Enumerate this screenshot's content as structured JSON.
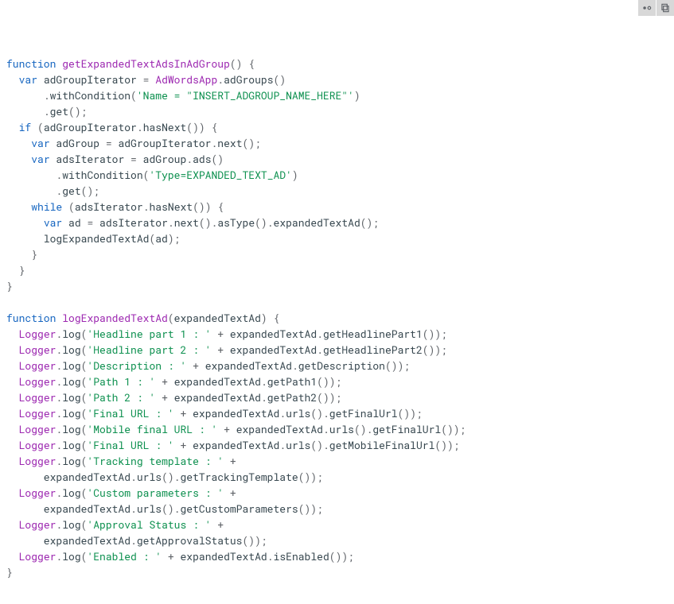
{
  "toolbar": {
    "btn_theme": "toggle-theme",
    "btn_copy": "copy-code"
  },
  "code_tokens": [
    [
      [
        "kw",
        "function"
      ],
      [
        "plain",
        " "
      ],
      [
        "fn",
        "getExpandedTextAdsInAdGroup"
      ],
      [
        "punc",
        "()"
      ],
      [
        "plain",
        " "
      ],
      [
        "punc",
        "{"
      ]
    ],
    [
      [
        "plain",
        "  "
      ],
      [
        "kw",
        "var"
      ],
      [
        "plain",
        " adGroupIterator "
      ],
      [
        "punc",
        "="
      ],
      [
        "plain",
        " "
      ],
      [
        "type",
        "AdWordsApp"
      ],
      [
        "punc",
        "."
      ],
      [
        "plain",
        "adGroups"
      ],
      [
        "punc",
        "()"
      ]
    ],
    [
      [
        "plain",
        "      "
      ],
      [
        "punc",
        "."
      ],
      [
        "plain",
        "withCondition"
      ],
      [
        "punc",
        "("
      ],
      [
        "str",
        "'Name = \"INSERT_ADGROUP_NAME_HERE\"'"
      ],
      [
        "punc",
        ")"
      ]
    ],
    [
      [
        "plain",
        "      "
      ],
      [
        "punc",
        "."
      ],
      [
        "plain",
        "get"
      ],
      [
        "punc",
        "();"
      ]
    ],
    [
      [
        "plain",
        "  "
      ],
      [
        "kw",
        "if"
      ],
      [
        "plain",
        " "
      ],
      [
        "punc",
        "("
      ],
      [
        "plain",
        "adGroupIterator"
      ],
      [
        "punc",
        "."
      ],
      [
        "plain",
        "hasNext"
      ],
      [
        "punc",
        "())"
      ],
      [
        "plain",
        " "
      ],
      [
        "punc",
        "{"
      ]
    ],
    [
      [
        "plain",
        "    "
      ],
      [
        "kw",
        "var"
      ],
      [
        "plain",
        " adGroup "
      ],
      [
        "punc",
        "="
      ],
      [
        "plain",
        " adGroupIterator"
      ],
      [
        "punc",
        "."
      ],
      [
        "plain",
        "next"
      ],
      [
        "punc",
        "();"
      ]
    ],
    [
      [
        "plain",
        "    "
      ],
      [
        "kw",
        "var"
      ],
      [
        "plain",
        " adsIterator "
      ],
      [
        "punc",
        "="
      ],
      [
        "plain",
        " adGroup"
      ],
      [
        "punc",
        "."
      ],
      [
        "plain",
        "ads"
      ],
      [
        "punc",
        "()"
      ]
    ],
    [
      [
        "plain",
        "        "
      ],
      [
        "punc",
        "."
      ],
      [
        "plain",
        "withCondition"
      ],
      [
        "punc",
        "("
      ],
      [
        "str",
        "'Type=EXPANDED_TEXT_AD'"
      ],
      [
        "punc",
        ")"
      ]
    ],
    [
      [
        "plain",
        "        "
      ],
      [
        "punc",
        "."
      ],
      [
        "plain",
        "get"
      ],
      [
        "punc",
        "();"
      ]
    ],
    [
      [
        "plain",
        "    "
      ],
      [
        "kw",
        "while"
      ],
      [
        "plain",
        " "
      ],
      [
        "punc",
        "("
      ],
      [
        "plain",
        "adsIterator"
      ],
      [
        "punc",
        "."
      ],
      [
        "plain",
        "hasNext"
      ],
      [
        "punc",
        "())"
      ],
      [
        "plain",
        " "
      ],
      [
        "punc",
        "{"
      ]
    ],
    [
      [
        "plain",
        "      "
      ],
      [
        "kw",
        "var"
      ],
      [
        "plain",
        " ad "
      ],
      [
        "punc",
        "="
      ],
      [
        "plain",
        " adsIterator"
      ],
      [
        "punc",
        "."
      ],
      [
        "plain",
        "next"
      ],
      [
        "punc",
        "()."
      ],
      [
        "plain",
        "asType"
      ],
      [
        "punc",
        "()."
      ],
      [
        "plain",
        "expandedTextAd"
      ],
      [
        "punc",
        "();"
      ]
    ],
    [
      [
        "plain",
        "      logExpandedTextAd"
      ],
      [
        "punc",
        "("
      ],
      [
        "plain",
        "ad"
      ],
      [
        "punc",
        ");"
      ]
    ],
    [
      [
        "plain",
        "    "
      ],
      [
        "punc",
        "}"
      ]
    ],
    [
      [
        "plain",
        "  "
      ],
      [
        "punc",
        "}"
      ]
    ],
    [
      [
        "punc",
        "}"
      ]
    ],
    [
      [
        "plain",
        ""
      ]
    ],
    [
      [
        "kw",
        "function"
      ],
      [
        "plain",
        " "
      ],
      [
        "fn",
        "logExpandedTextAd"
      ],
      [
        "punc",
        "("
      ],
      [
        "plain",
        "expandedTextAd"
      ],
      [
        "punc",
        ")"
      ],
      [
        "plain",
        " "
      ],
      [
        "punc",
        "{"
      ]
    ],
    [
      [
        "plain",
        "  "
      ],
      [
        "type",
        "Logger"
      ],
      [
        "punc",
        "."
      ],
      [
        "plain",
        "log"
      ],
      [
        "punc",
        "("
      ],
      [
        "str",
        "'Headline part 1 : '"
      ],
      [
        "plain",
        " "
      ],
      [
        "punc",
        "+"
      ],
      [
        "plain",
        " expandedTextAd"
      ],
      [
        "punc",
        "."
      ],
      [
        "plain",
        "getHeadlinePart1"
      ],
      [
        "punc",
        "());"
      ]
    ],
    [
      [
        "plain",
        "  "
      ],
      [
        "type",
        "Logger"
      ],
      [
        "punc",
        "."
      ],
      [
        "plain",
        "log"
      ],
      [
        "punc",
        "("
      ],
      [
        "str",
        "'Headline part 2 : '"
      ],
      [
        "plain",
        " "
      ],
      [
        "punc",
        "+"
      ],
      [
        "plain",
        " expandedTextAd"
      ],
      [
        "punc",
        "."
      ],
      [
        "plain",
        "getHeadlinePart2"
      ],
      [
        "punc",
        "());"
      ]
    ],
    [
      [
        "plain",
        "  "
      ],
      [
        "type",
        "Logger"
      ],
      [
        "punc",
        "."
      ],
      [
        "plain",
        "log"
      ],
      [
        "punc",
        "("
      ],
      [
        "str",
        "'Description : '"
      ],
      [
        "plain",
        " "
      ],
      [
        "punc",
        "+"
      ],
      [
        "plain",
        " expandedTextAd"
      ],
      [
        "punc",
        "."
      ],
      [
        "plain",
        "getDescription"
      ],
      [
        "punc",
        "());"
      ]
    ],
    [
      [
        "plain",
        "  "
      ],
      [
        "type",
        "Logger"
      ],
      [
        "punc",
        "."
      ],
      [
        "plain",
        "log"
      ],
      [
        "punc",
        "("
      ],
      [
        "str",
        "'Path 1 : '"
      ],
      [
        "plain",
        " "
      ],
      [
        "punc",
        "+"
      ],
      [
        "plain",
        " expandedTextAd"
      ],
      [
        "punc",
        "."
      ],
      [
        "plain",
        "getPath1"
      ],
      [
        "punc",
        "());"
      ]
    ],
    [
      [
        "plain",
        "  "
      ],
      [
        "type",
        "Logger"
      ],
      [
        "punc",
        "."
      ],
      [
        "plain",
        "log"
      ],
      [
        "punc",
        "("
      ],
      [
        "str",
        "'Path 2 : '"
      ],
      [
        "plain",
        " "
      ],
      [
        "punc",
        "+"
      ],
      [
        "plain",
        " expandedTextAd"
      ],
      [
        "punc",
        "."
      ],
      [
        "plain",
        "getPath2"
      ],
      [
        "punc",
        "());"
      ]
    ],
    [
      [
        "plain",
        "  "
      ],
      [
        "type",
        "Logger"
      ],
      [
        "punc",
        "."
      ],
      [
        "plain",
        "log"
      ],
      [
        "punc",
        "("
      ],
      [
        "str",
        "'Final URL : '"
      ],
      [
        "plain",
        " "
      ],
      [
        "punc",
        "+"
      ],
      [
        "plain",
        " expandedTextAd"
      ],
      [
        "punc",
        "."
      ],
      [
        "plain",
        "urls"
      ],
      [
        "punc",
        "()."
      ],
      [
        "plain",
        "getFinalUrl"
      ],
      [
        "punc",
        "());"
      ]
    ],
    [
      [
        "plain",
        "  "
      ],
      [
        "type",
        "Logger"
      ],
      [
        "punc",
        "."
      ],
      [
        "plain",
        "log"
      ],
      [
        "punc",
        "("
      ],
      [
        "str",
        "'Mobile final URL : '"
      ],
      [
        "plain",
        " "
      ],
      [
        "punc",
        "+"
      ],
      [
        "plain",
        " expandedTextAd"
      ],
      [
        "punc",
        "."
      ],
      [
        "plain",
        "urls"
      ],
      [
        "punc",
        "()."
      ],
      [
        "plain",
        "getFinalUrl"
      ],
      [
        "punc",
        "());"
      ]
    ],
    [
      [
        "plain",
        "  "
      ],
      [
        "type",
        "Logger"
      ],
      [
        "punc",
        "."
      ],
      [
        "plain",
        "log"
      ],
      [
        "punc",
        "("
      ],
      [
        "str",
        "'Final URL : '"
      ],
      [
        "plain",
        " "
      ],
      [
        "punc",
        "+"
      ],
      [
        "plain",
        " expandedTextAd"
      ],
      [
        "punc",
        "."
      ],
      [
        "plain",
        "urls"
      ],
      [
        "punc",
        "()."
      ],
      [
        "plain",
        "getMobileFinalUrl"
      ],
      [
        "punc",
        "());"
      ]
    ],
    [
      [
        "plain",
        "  "
      ],
      [
        "type",
        "Logger"
      ],
      [
        "punc",
        "."
      ],
      [
        "plain",
        "log"
      ],
      [
        "punc",
        "("
      ],
      [
        "str",
        "'Tracking template : '"
      ],
      [
        "plain",
        " "
      ],
      [
        "punc",
        "+"
      ]
    ],
    [
      [
        "plain",
        "      expandedTextAd"
      ],
      [
        "punc",
        "."
      ],
      [
        "plain",
        "urls"
      ],
      [
        "punc",
        "()."
      ],
      [
        "plain",
        "getTrackingTemplate"
      ],
      [
        "punc",
        "());"
      ]
    ],
    [
      [
        "plain",
        "  "
      ],
      [
        "type",
        "Logger"
      ],
      [
        "punc",
        "."
      ],
      [
        "plain",
        "log"
      ],
      [
        "punc",
        "("
      ],
      [
        "str",
        "'Custom parameters : '"
      ],
      [
        "plain",
        " "
      ],
      [
        "punc",
        "+"
      ]
    ],
    [
      [
        "plain",
        "      expandedTextAd"
      ],
      [
        "punc",
        "."
      ],
      [
        "plain",
        "urls"
      ],
      [
        "punc",
        "()."
      ],
      [
        "plain",
        "getCustomParameters"
      ],
      [
        "punc",
        "());"
      ]
    ],
    [
      [
        "plain",
        "  "
      ],
      [
        "type",
        "Logger"
      ],
      [
        "punc",
        "."
      ],
      [
        "plain",
        "log"
      ],
      [
        "punc",
        "("
      ],
      [
        "str",
        "'Approval Status : '"
      ],
      [
        "plain",
        " "
      ],
      [
        "punc",
        "+"
      ]
    ],
    [
      [
        "plain",
        "      expandedTextAd"
      ],
      [
        "punc",
        "."
      ],
      [
        "plain",
        "getApprovalStatus"
      ],
      [
        "punc",
        "());"
      ]
    ],
    [
      [
        "plain",
        "  "
      ],
      [
        "type",
        "Logger"
      ],
      [
        "punc",
        "."
      ],
      [
        "plain",
        "log"
      ],
      [
        "punc",
        "("
      ],
      [
        "str",
        "'Enabled : '"
      ],
      [
        "plain",
        " "
      ],
      [
        "punc",
        "+"
      ],
      [
        "plain",
        " expandedTextAd"
      ],
      [
        "punc",
        "."
      ],
      [
        "plain",
        "isEnabled"
      ],
      [
        "punc",
        "());"
      ]
    ],
    [
      [
        "punc",
        "}"
      ]
    ]
  ]
}
